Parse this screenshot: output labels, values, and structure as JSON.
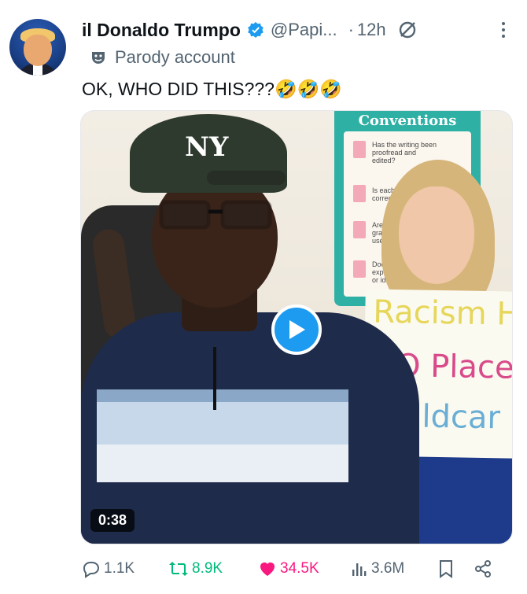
{
  "author": {
    "display_name": "il Donaldo Trumpo",
    "handle": "@Papi...",
    "separator": "·",
    "timestamp": "12h",
    "label": "Parody account"
  },
  "tweet": {
    "text": "OK, WHO DID THIS???🤣🤣🤣"
  },
  "media": {
    "type": "video",
    "duration": "0:38",
    "cap_logo": "NY",
    "poster_title": "Conventions",
    "poster_lines": [
      "Has the writing been",
      "proofread and",
      "edited?",
      "Is each w",
      "correct",
      "Are co",
      "gramm",
      "used",
      "Does",
      "expl",
      "or ide"
    ],
    "sign_lines": [
      "Racism H",
      "NO Place",
      "Childcar"
    ]
  },
  "actions": {
    "replies": "1.1K",
    "retweets": "8.9K",
    "likes": "34.5K",
    "views": "3.6M"
  },
  "colors": {
    "accent": "#1d9bf0",
    "like": "#f91880",
    "retweet": "#00ba7c",
    "muted": "#536471"
  }
}
